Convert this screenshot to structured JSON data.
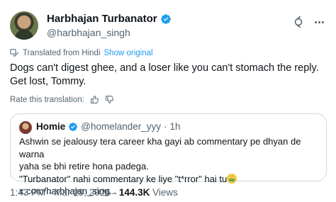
{
  "author": {
    "display_name": "Harbhajan Turbanator",
    "handle": "@harbhajan_singh",
    "verified_color": "#1d9bf0"
  },
  "translation": {
    "note": "Translated from Hindi",
    "show_original": "Show original",
    "rate": "Rate this translation:"
  },
  "tweet": {
    "text": "Dogs can't digest ghee, and a loser like you can't stomach the reply. Get lost, Tommy."
  },
  "quote": {
    "name": "Homie",
    "handle": "@homelander_yyy",
    "separator": "·",
    "time": "1h",
    "line1": "Ashwin se jealousy tera career kha gayi ab commentary pe dhyan de warna",
    "line2": "yaha se bhi retire hona padega.",
    "line3_a": "\"Turbanator\" nahi commentary ke liye \"t*rror\" hai tu",
    "line3_b": " x.com/harbhajan_sing..."
  },
  "meta": {
    "time": "1:43 PM",
    "sep1": " · ",
    "date": "Mar 29, 2026",
    "sep2": " · ",
    "views_count": "144.3K",
    "views_label": " Views"
  },
  "icons": [
    "grok-icon",
    "more-icon",
    "translate-icon",
    "thumbs-up-icon",
    "thumbs-down-icon",
    "verified-badge-icon",
    "nauseated-emoji-icon"
  ]
}
